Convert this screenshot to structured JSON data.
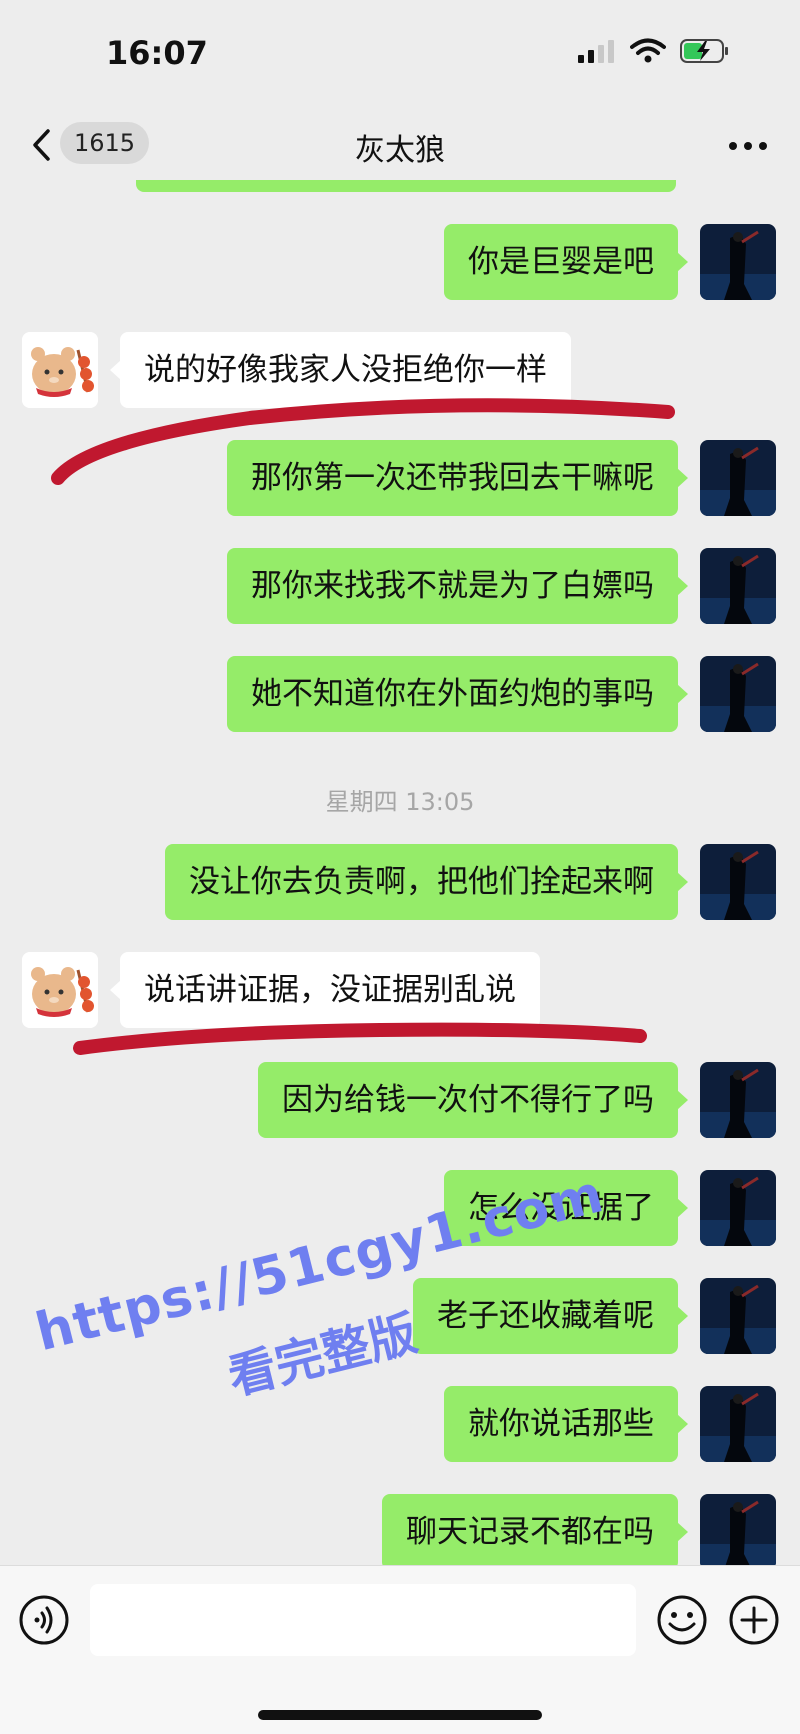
{
  "status_bar": {
    "time": "16:07"
  },
  "nav": {
    "unread_badge": "1615",
    "title": "灰太狼"
  },
  "messages": [
    {
      "side": "right",
      "text": "你是巨婴是吧"
    },
    {
      "side": "left",
      "text": "说的好像我家人没拒绝你一样"
    },
    {
      "side": "right",
      "text": "那你第一次还带我回去干嘛呢"
    },
    {
      "side": "right",
      "text": "那你来找我不就是为了白嫖吗"
    },
    {
      "side": "right",
      "text": "她不知道你在外面约炮的事吗"
    },
    {
      "side": "right",
      "text": "没让你去负责啊，把他们拴起来啊"
    },
    {
      "side": "left",
      "text": "说话讲证据，没证据别乱说"
    },
    {
      "side": "right",
      "text": "因为给钱一次付不得行了吗"
    },
    {
      "side": "right",
      "text": "怎么没证据了"
    },
    {
      "side": "right",
      "text": "老子还收藏着呢"
    },
    {
      "side": "right",
      "text": "就你说话那些"
    },
    {
      "side": "right",
      "text": "聊天记录不都在吗"
    }
  ],
  "timestamp": "星期四 13:05",
  "watermark": {
    "line1": "https://51cgy1.com",
    "line2": "看完整版"
  },
  "colors": {
    "bubble_sent": "#95ec69",
    "bubble_received": "#ffffff",
    "background": "#ededed",
    "annotation_stroke": "#c0182f",
    "watermark": "#6f7ff0"
  },
  "icons": {
    "back": "chevron-left-icon",
    "more": "ellipsis-icon",
    "voice": "voice-input-icon",
    "emoji": "emoji-icon",
    "plus": "plus-circle-icon"
  }
}
